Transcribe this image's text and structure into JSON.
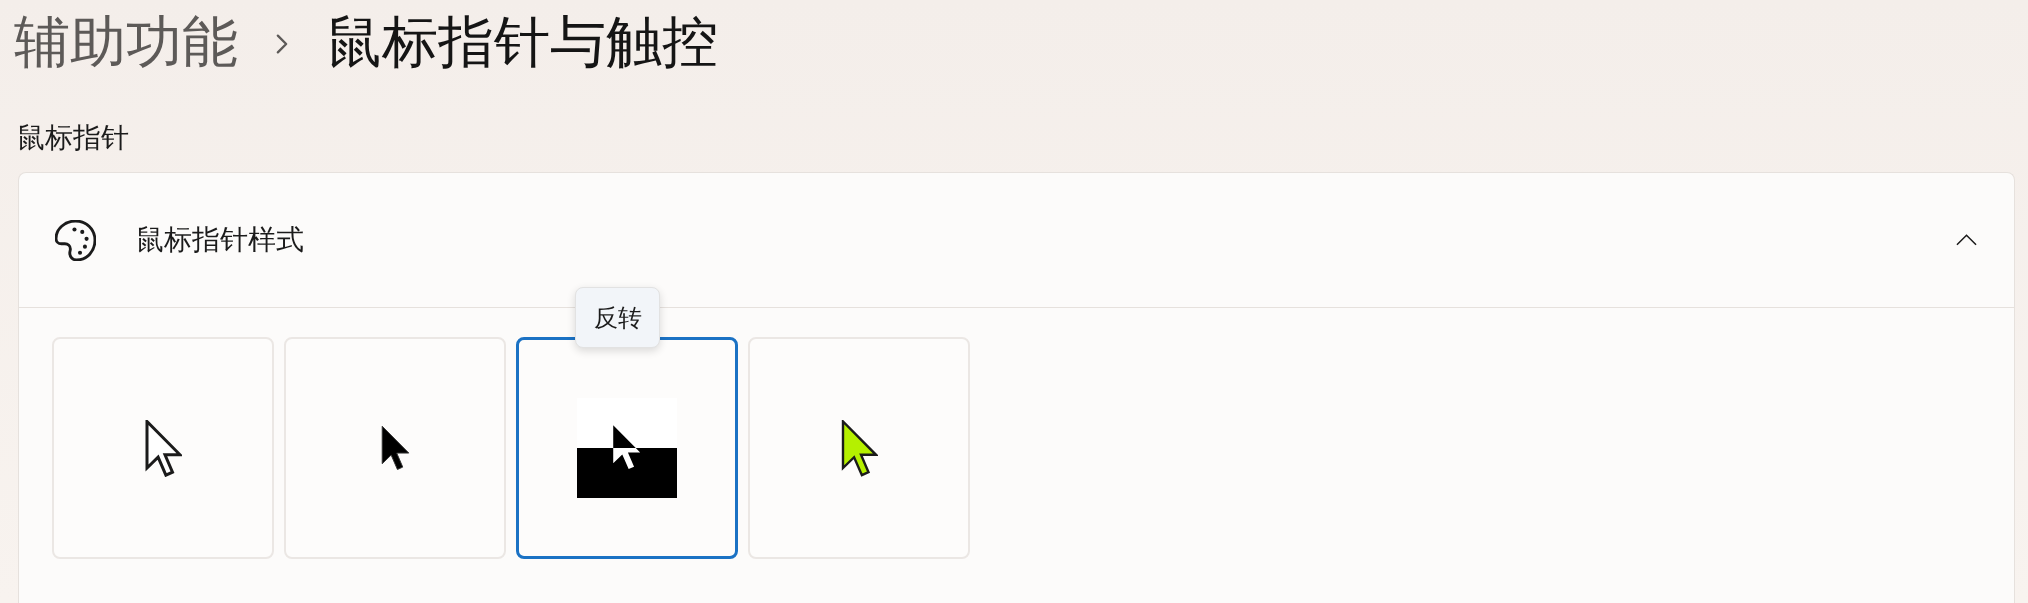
{
  "breadcrumb": [
    {
      "label": "辅助功能",
      "current": false
    },
    {
      "label": "鼠标指针与触控",
      "current": true
    }
  ],
  "section": {
    "title": "鼠标指针"
  },
  "card": {
    "title": "鼠标指针样式",
    "expanded": true,
    "styles": [
      {
        "kind": "white",
        "selected": false
      },
      {
        "kind": "black",
        "selected": false
      },
      {
        "kind": "inverted",
        "selected": true,
        "tooltip": "反转"
      },
      {
        "kind": "custom",
        "selected": false,
        "color": "#b5f000"
      }
    ]
  }
}
